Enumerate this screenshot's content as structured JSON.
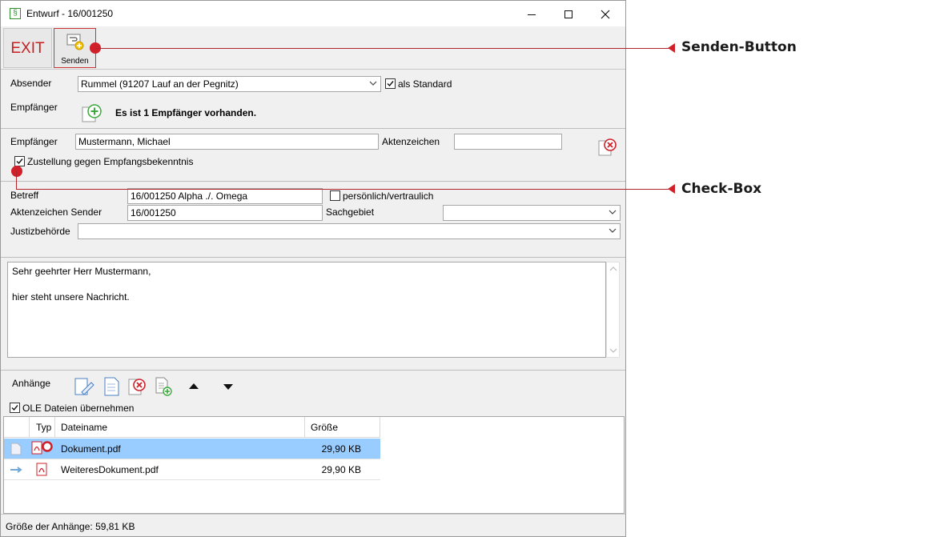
{
  "window": {
    "title": "Entwurf - 16/001250",
    "app_icon_glyph": "§"
  },
  "toolbar": {
    "exit_label": "EXIT",
    "send_label": "Senden"
  },
  "sender": {
    "label": "Absender",
    "value": "Rummel (91207 Lauf an der Pegnitz)",
    "standard_label": "als Standard",
    "standard_checked": true
  },
  "recipients": {
    "label": "Empfänger",
    "info": "Es ist 1 Empfänger vorhanden."
  },
  "recipient": {
    "label": "Empfänger",
    "value": "Mustermann, Michael",
    "file_ref_label": "Aktenzeichen",
    "file_ref_value": "",
    "delivery_label": "Zustellung gegen Empfangsbekenntnis",
    "delivery_checked": true
  },
  "details": {
    "subject_label": "Betreff",
    "subject_value": "16/001250 Alpha ./. Omega",
    "confidential_label": "persönlich/vertraulich",
    "confidential_checked": false,
    "sender_ref_label": "Aktenzeichen Sender",
    "sender_ref_value": "16/001250",
    "subject_area_label": "Sachgebiet",
    "subject_area_value": "",
    "authority_label": "Justizbehörde",
    "authority_value": ""
  },
  "message": {
    "lines": [
      "Sehr geehrter Herr Mustermann,",
      "",
      "hier steht unsere Nachricht."
    ]
  },
  "attachments": {
    "label": "Anhänge",
    "ole_label": "OLE Dateien übernehmen",
    "ole_checked": true,
    "columns": [
      "Typ",
      "Dateiname",
      "Größe"
    ],
    "rows": [
      {
        "name": "Dokument.pdf",
        "size": "29,90 KB",
        "selected": true
      },
      {
        "name": "WeiteresDokument.pdf",
        "size": "29,90 KB",
        "selected": false
      }
    ]
  },
  "status": {
    "text": "Größe der Anhänge:   59,81 KB"
  },
  "annotations": {
    "send_button": "Senden-Button",
    "checkbox": "Check-Box"
  },
  "colors": {
    "accent_red": "#d0202a",
    "selection": "#99ccff",
    "exit_red": "#c81e1e"
  }
}
